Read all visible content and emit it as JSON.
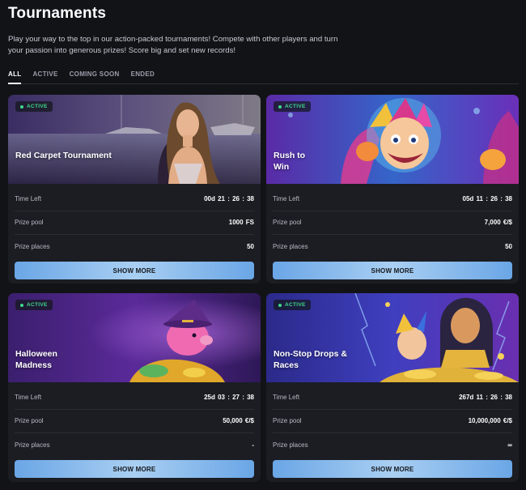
{
  "page": {
    "title": "Tournaments",
    "intro": "Play your way to the top in our action-packed tournaments! Compete with other players and turn your passion into generous prizes! Score big and set new records!"
  },
  "tabs": [
    {
      "label": "ALL",
      "active": true
    },
    {
      "label": "ACTIVE",
      "active": false
    },
    {
      "label": "COMING SOON",
      "active": false
    },
    {
      "label": "ENDED",
      "active": false
    }
  ],
  "colors": {
    "background": "#121317",
    "card": "#1b1d23",
    "status_active": "#3fd98a",
    "button_gradient": [
      "#6aa6e6",
      "#a9cff2"
    ]
  },
  "row_labels": {
    "time_left": "Time Left",
    "prize_pool": "Prize pool",
    "prize_places": "Prize places"
  },
  "tournaments": [
    {
      "status": "ACTIVE",
      "title": "Red Carpet Tournament",
      "time_left": "00d  21 : 26 : 38",
      "prize_pool": "1000 FS",
      "prize_places": "50",
      "button": "SHOW MORE"
    },
    {
      "status": "ACTIVE",
      "title": "Rush to Win",
      "time_left": "05d  11 : 26 : 38",
      "prize_pool": "7,000 €/$",
      "prize_places": "50",
      "button": "SHOW MORE"
    },
    {
      "status": "ACTIVE",
      "title": "Halloween Madness",
      "time_left": "25d  03 : 27 : 38",
      "prize_pool": "50,000 €/$",
      "prize_places": "-",
      "button": "SHOW MORE"
    },
    {
      "status": "ACTIVE",
      "title": "Non-Stop Drops & Races",
      "time_left": "267d  11 : 26 : 38",
      "prize_pool": "10,000,000 €/$",
      "prize_places": "∞",
      "button": "SHOW MORE"
    }
  ]
}
